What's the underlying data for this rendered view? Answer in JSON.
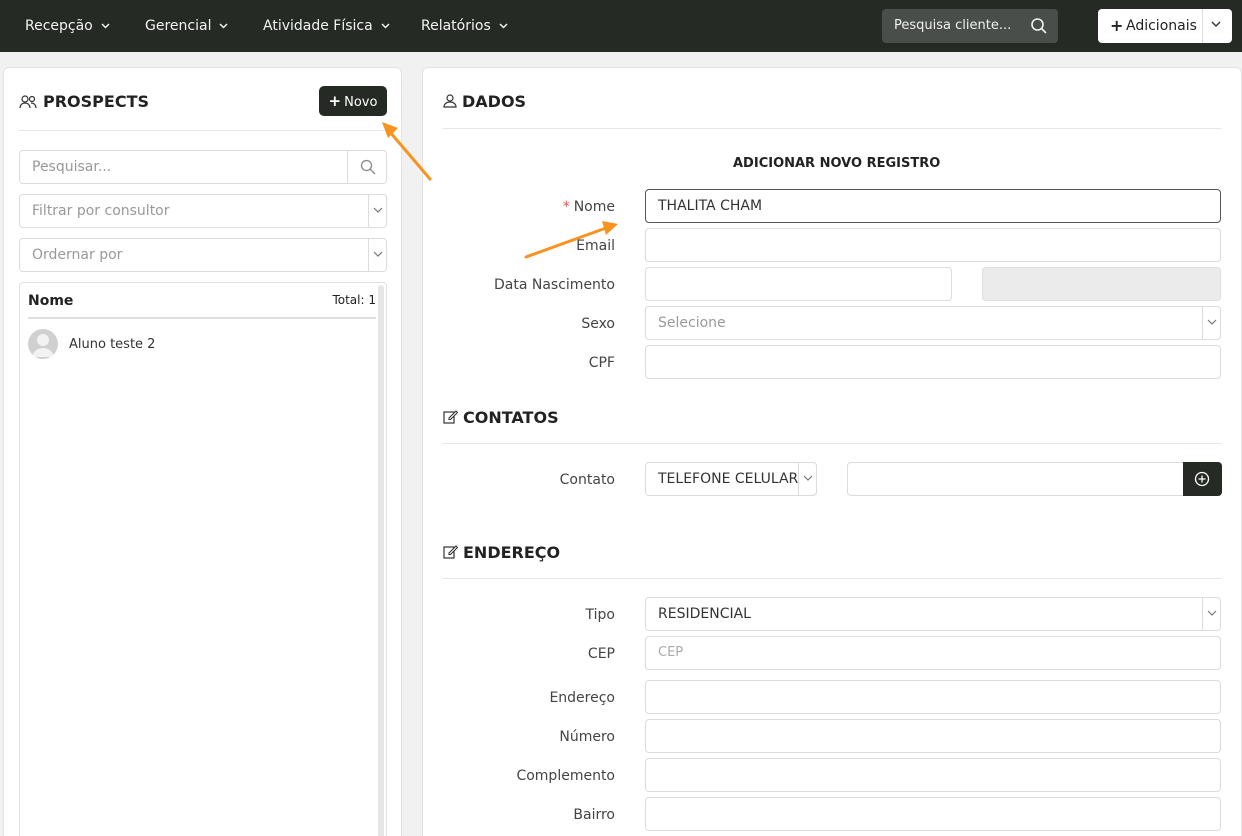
{
  "nav": {
    "items": [
      {
        "label": "Recepção"
      },
      {
        "label": "Gerencial"
      },
      {
        "label": "Atividade Física"
      },
      {
        "label": "Relatórios"
      }
    ],
    "search_placeholder": "Pesquisa cliente...",
    "add_label": "Adicionais"
  },
  "prospects": {
    "title": "PROSPECTS",
    "new_button": "Novo",
    "search_placeholder": "Pesquisar...",
    "filter_placeholder": "Filtrar por consultor",
    "order_placeholder": "Ordernar por",
    "list_header": "Nome",
    "total": "Total: 1",
    "items": [
      {
        "name": "Aluno teste 2"
      }
    ]
  },
  "dados": {
    "title": "DADOS",
    "form_title": "ADICIONAR NOVO REGISTRO",
    "nome_label": "Nome",
    "nome_value": "THALITA CHAM",
    "email_label": "Email",
    "nascimento_label": "Data Nascimento",
    "sexo_label": "Sexo",
    "sexo_placeholder": "Selecione",
    "cpf_label": "CPF"
  },
  "contatos": {
    "title": "CONTATOS",
    "contato_label": "Contato",
    "contato_tipo": "TELEFONE CELULAR"
  },
  "endereco": {
    "title": "ENDEREÇO",
    "tipo_label": "Tipo",
    "tipo_value": "RESIDENCIAL",
    "cep_label": "CEP",
    "cep_placeholder": "CEP",
    "endereco_label": "Endereço",
    "numero_label": "Número",
    "complemento_label": "Complemento",
    "bairro_label": "Bairro"
  },
  "colors": {
    "nav_bg": "#262a25",
    "accent_arrow": "#f7931e",
    "required": "#d9534f"
  }
}
